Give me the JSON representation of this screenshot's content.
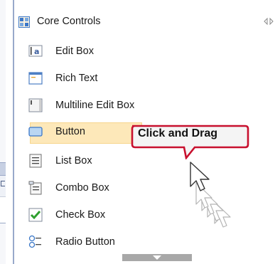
{
  "palette": {
    "header": {
      "title": "Core Controls"
    },
    "items": [
      {
        "label": "Edit Box",
        "icon": "edit-box-icon"
      },
      {
        "label": "Rich Text",
        "icon": "rich-text-icon"
      },
      {
        "label": "Multiline Edit Box",
        "icon": "multiline-edit-box-icon"
      },
      {
        "label": "Button",
        "icon": "button-icon",
        "selected": true
      },
      {
        "label": "List Box",
        "icon": "list-box-icon"
      },
      {
        "label": "Combo Box",
        "icon": "combo-box-icon"
      },
      {
        "label": "Check Box",
        "icon": "check-box-icon"
      },
      {
        "label": "Radio Button",
        "icon": "radio-button-icon"
      }
    ]
  },
  "callout": {
    "text": "Click and Drag"
  },
  "colors": {
    "selected_bg": "#fde8b9",
    "callout_border": "#c8102e",
    "palette_border": "#98a9cb"
  }
}
